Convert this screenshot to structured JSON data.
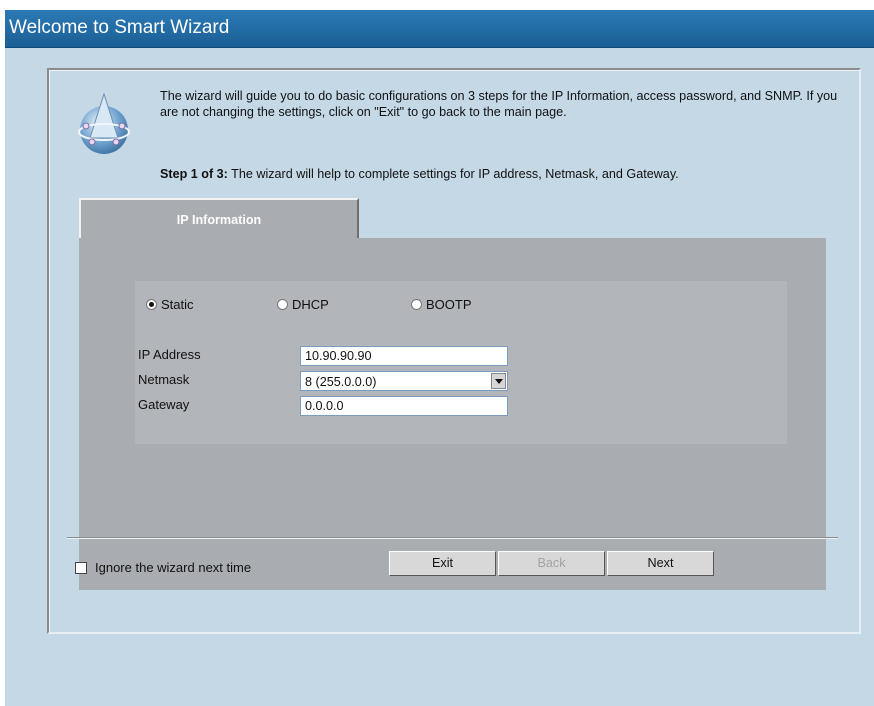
{
  "window": {
    "title": "Welcome to Smart Wizard"
  },
  "intro": {
    "text": "The wizard will guide you to do basic configurations on 3 steps for the IP Information, access password, and SNMP. If you are not changing the settings, click on \"Exit\" to go back to the main page.",
    "step_prefix": "Step 1 of 3:",
    "step_text": " The wizard will help to complete settings for IP address, Netmask, and Gateway."
  },
  "tab": {
    "label": "IP Information"
  },
  "mode": {
    "options": [
      {
        "label": "Static",
        "checked": true
      },
      {
        "label": "DHCP",
        "checked": false
      },
      {
        "label": "BOOTP",
        "checked": false
      }
    ]
  },
  "fields": {
    "ip_label": "IP Address",
    "ip_value": "10.90.90.90",
    "netmask_label": "Netmask",
    "netmask_value": "8 (255.0.0.0)",
    "gateway_label": "Gateway",
    "gateway_value": "0.0.0.0"
  },
  "footer": {
    "ignore_label": "Ignore the wizard next time",
    "ignore_checked": false,
    "exit_label": "Exit",
    "back_label": "Back",
    "next_label": "Next"
  },
  "icons": {
    "logo": "smart-wizard-globe-icon",
    "dropdown": "chevron-down-icon"
  },
  "colors": {
    "titlebar": "#1f6aa5",
    "background": "#c5d8e6",
    "tab": "#a9acb0"
  }
}
